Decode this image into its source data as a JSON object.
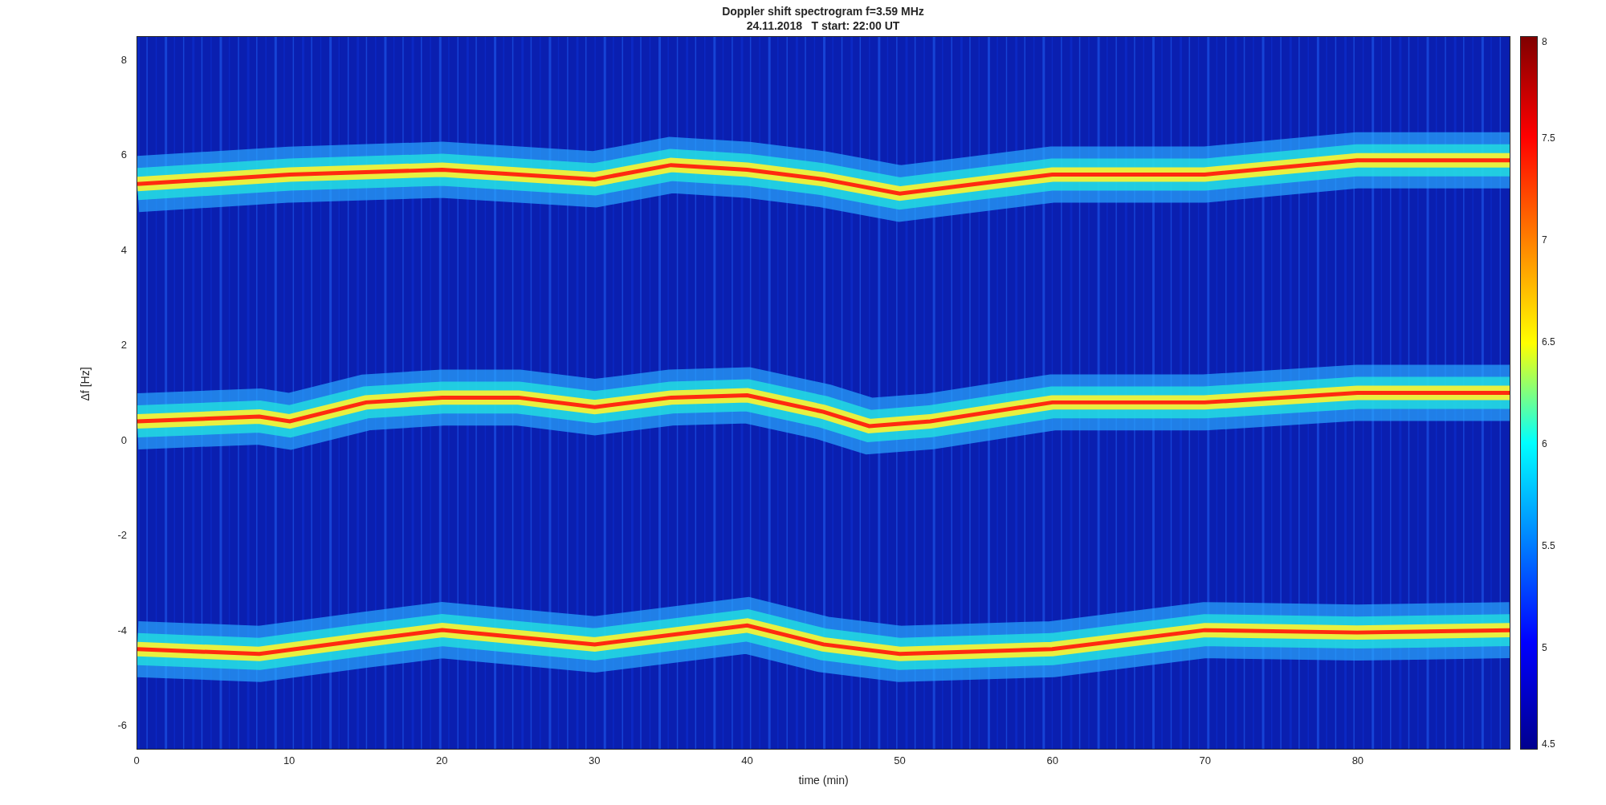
{
  "figure": {
    "title_lines": [
      "Doppler shift spectrogram f=3.59 MHz",
      "24.11.2018   T start: 22:00 UT"
    ]
  },
  "axes": {
    "ylabel": "Δf [Hz]",
    "xlabel": "time (min)",
    "yticks": [
      "8",
      "6",
      "4",
      "2",
      "0",
      "-2",
      "-4",
      "-6"
    ],
    "xticks": [
      "0",
      "10",
      "20",
      "30",
      "40",
      "50",
      "60",
      "70",
      "80"
    ]
  },
  "colorbar": {
    "ticks": [
      "8",
      "7.5",
      "7",
      "6.5",
      "6",
      "5.5",
      "5",
      "4.5"
    ]
  }
}
